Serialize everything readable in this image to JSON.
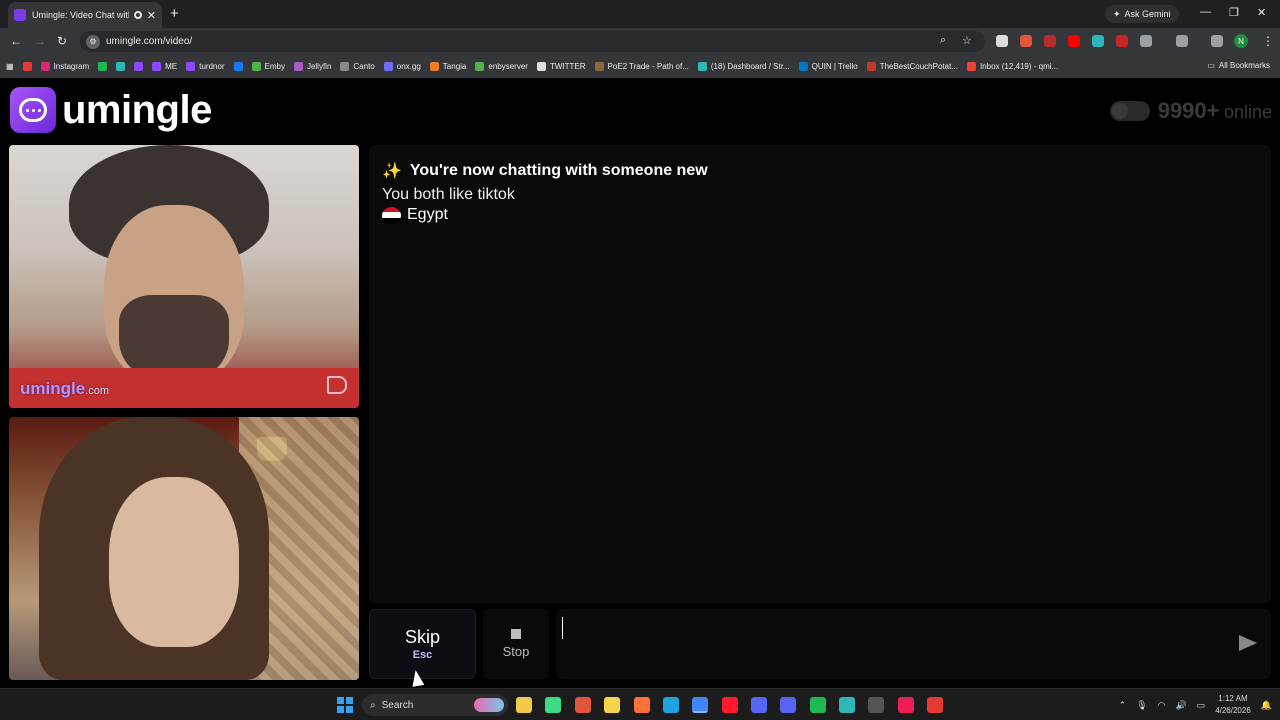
{
  "browser": {
    "tab_title": "Umingle: Video Chat with S",
    "tab_close": "✕",
    "new_tab": "+",
    "ask_gemini": "Ask Gemini",
    "url": "umingle.com/video/",
    "profile_initial": "N",
    "bookmarks": [
      {
        "label": "",
        "color": "#e53935"
      },
      {
        "label": "Instagram",
        "color": "#d62976"
      },
      {
        "label": "",
        "color": "#1db954"
      },
      {
        "label": "",
        "color": "#2fb6b6"
      },
      {
        "label": "",
        "color": "#9146ff"
      },
      {
        "label": "ME",
        "color": "#9146ff"
      },
      {
        "label": "turdnor",
        "color": "#9146ff"
      },
      {
        "label": "",
        "color": "#1877f2"
      },
      {
        "label": "Emby",
        "color": "#52b54b"
      },
      {
        "label": "Jellyfin",
        "color": "#aa5cc3"
      },
      {
        "label": "Canto",
        "color": "#8a8a8a"
      },
      {
        "label": "onx.gg",
        "color": "#6c6cff"
      },
      {
        "label": "Tangia",
        "color": "#f47b20"
      },
      {
        "label": "enbyserver",
        "color": "#52b54b"
      },
      {
        "label": "TWITTER",
        "color": "#e0e0e0"
      },
      {
        "label": "PoE2 Trade - Path of...",
        "color": "#8a6a3a"
      },
      {
        "label": "(18) Dashboard / Str...",
        "color": "#2fb6b6"
      },
      {
        "label": "QUIN | Trello",
        "color": "#0079bf"
      },
      {
        "label": "TheBestCouchPotat...",
        "color": "#c0392b"
      },
      {
        "label": "Inbox (12,419) - qmi...",
        "color": "#ea4335"
      }
    ],
    "all_bookmarks": "All Bookmarks"
  },
  "site": {
    "brand": "umingle",
    "online_count": "9990+",
    "online_label": "online"
  },
  "remote_video": {
    "watermark": "umingle",
    "watermark_suffix": ".com"
  },
  "chat": {
    "headline": "You're now chatting with someone new",
    "shared_interest": "You both like tiktok",
    "country": "Egypt",
    "message_placeholder": ""
  },
  "controls": {
    "skip_label": "Skip",
    "skip_shortcut": "Esc",
    "stop_label": "Stop"
  },
  "taskbar": {
    "search_label": "Search",
    "time": "1:12 AM",
    "date": "4/26/2026"
  },
  "colors": {
    "brand_purple": "#7c3aed",
    "accent_lavender": "#c9b8ff",
    "egypt_flag": [
      "#ce1126",
      "#ffffff",
      "#000000"
    ]
  }
}
